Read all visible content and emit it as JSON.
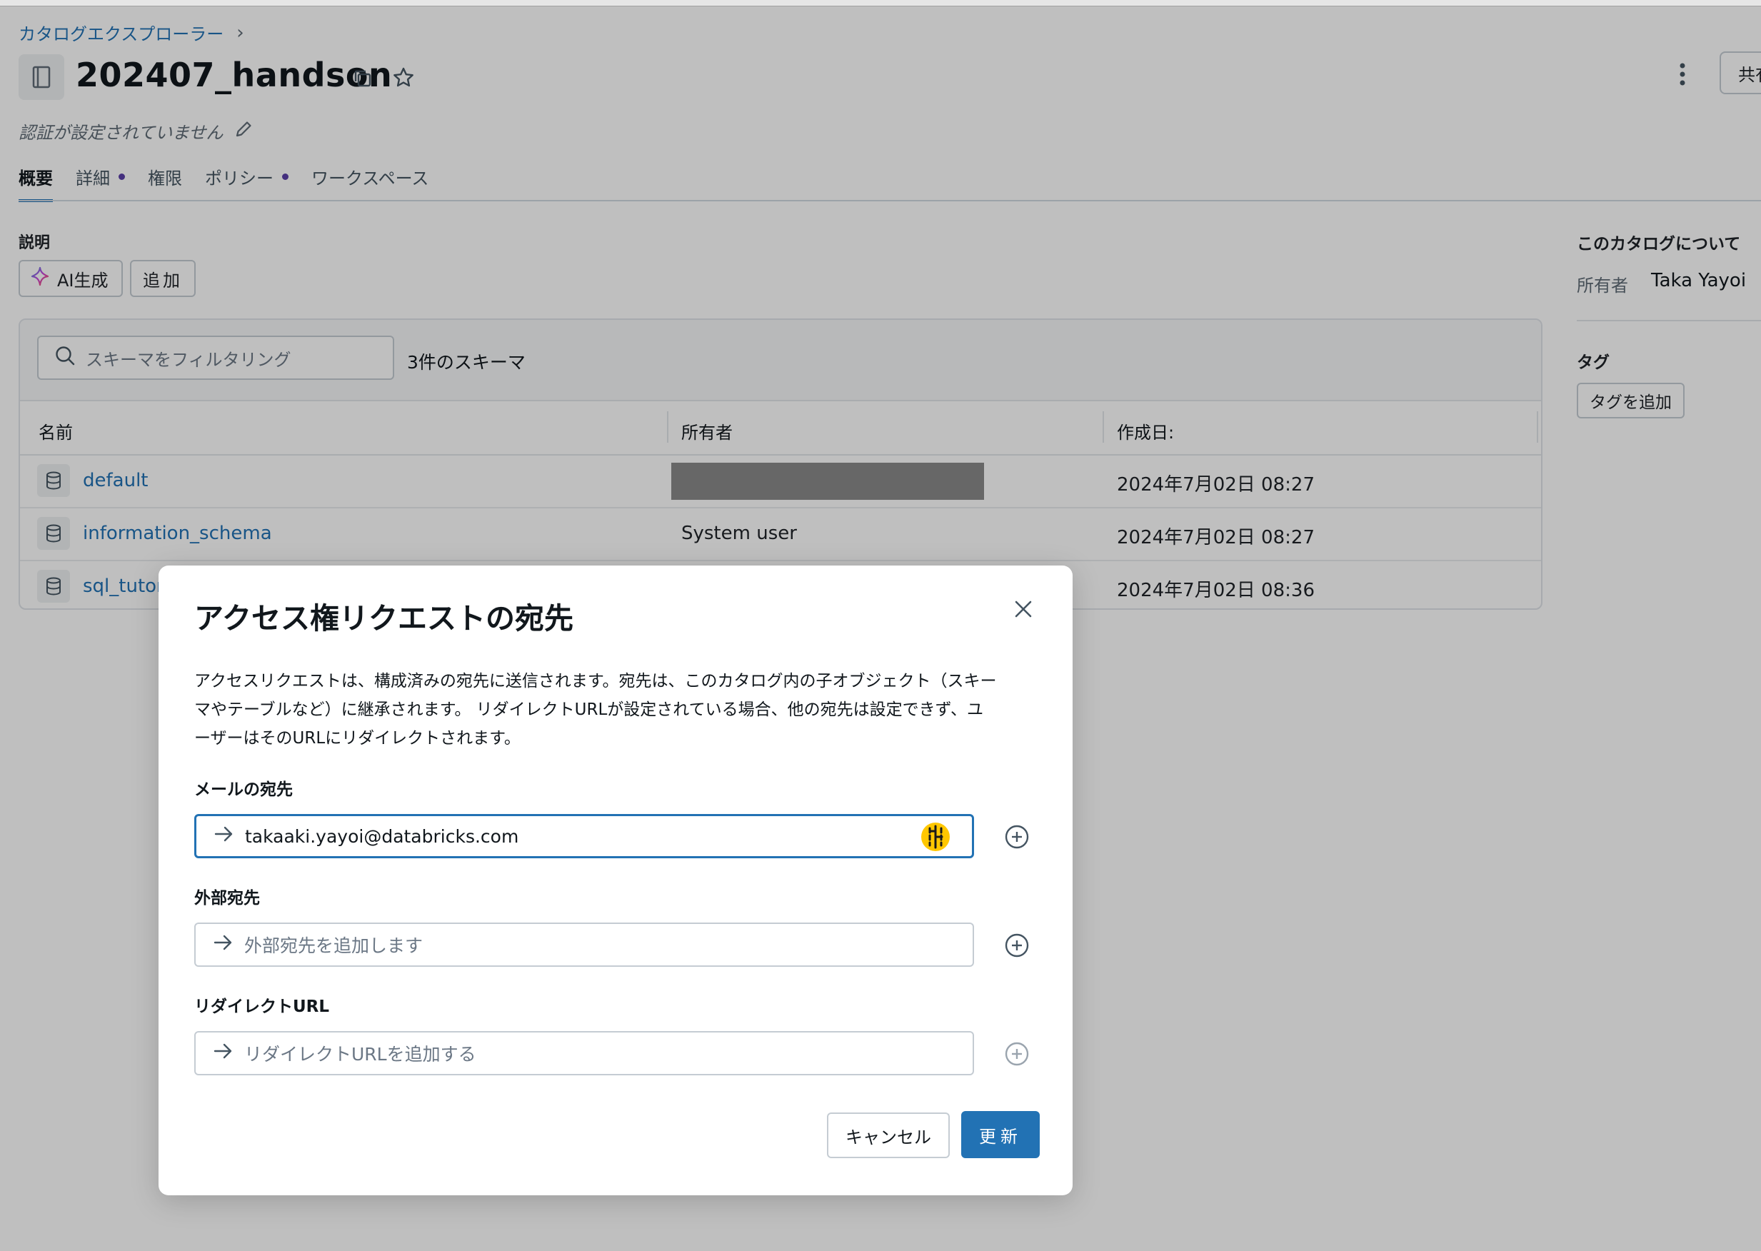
{
  "breadcrumb": {
    "root": "カタログエクスプローラー",
    "separator": "›"
  },
  "header": {
    "title": "202407_handson",
    "unverified_text": "認証が設定されていません",
    "share_label": "共有"
  },
  "tabs": [
    {
      "label": "概要",
      "active": true,
      "dot": false
    },
    {
      "label": "詳細",
      "active": false,
      "dot": true
    },
    {
      "label": "権限",
      "active": false,
      "dot": false
    },
    {
      "label": "ポリシー",
      "active": false,
      "dot": true
    },
    {
      "label": "ワークスペース",
      "active": false,
      "dot": false
    }
  ],
  "description": {
    "label": "説明",
    "ai_button": "AI生成",
    "add_button": "追加"
  },
  "about": {
    "title": "このカタログについて",
    "owner_label": "所有者",
    "owner_value": "Taka Yayoi",
    "tag_title": "タグ",
    "tag_button": "タグを追加"
  },
  "schemas": {
    "filter_placeholder": "スキーマをフィルタリング",
    "count_text": "3件のスキーマ",
    "columns": [
      "名前",
      "所有者",
      "作成日:"
    ],
    "rows": [
      {
        "name": "default",
        "owner": "",
        "created": "2024年7月02日 08:27",
        "owner_redacted": true
      },
      {
        "name": "information_schema",
        "owner": "System user",
        "created": "2024年7月02日 08:27",
        "owner_redacted": false
      },
      {
        "name": "sql_tutor",
        "owner": "",
        "created": "2024年7月02日 08:36",
        "owner_redacted": false
      }
    ]
  },
  "modal": {
    "title": "アクセス権リクエストの宛先",
    "body_lines": [
      "アクセスリクエストは、構成済みの宛先に送信されます。宛先は、このカタログ内の子オブジェクト（スキー",
      "マやテーブルなど）に継承されます。 リダイレクトURLが設定されている場合、他の宛先は設定できず、ユ",
      "ーザーはそのURLにリダイレクトされます。"
    ],
    "email_label": "メールの宛先",
    "email_value": "takaaki.yayoi@databricks.com",
    "external_label": "外部宛先",
    "external_placeholder": "外部宛先を追加します",
    "redirect_label": "リダイレクトURL",
    "redirect_placeholder": "リダイレクトURLを追加する",
    "cancel_label": "キャンセル",
    "update_label": "更新"
  },
  "colors": {
    "accent": "#2272b4",
    "link": "#2272b4",
    "dot": "#5b3fa8",
    "overlay": "rgba(0,0,0,0.25)"
  },
  "icons": [
    "catalog-icon",
    "copy-icon",
    "star-icon",
    "kebab-icon",
    "pencil-icon",
    "sparkle-icon",
    "search-icon",
    "database-icon",
    "close-icon",
    "arrow-right-icon",
    "plus-circle-icon",
    "keeper-icon"
  ]
}
